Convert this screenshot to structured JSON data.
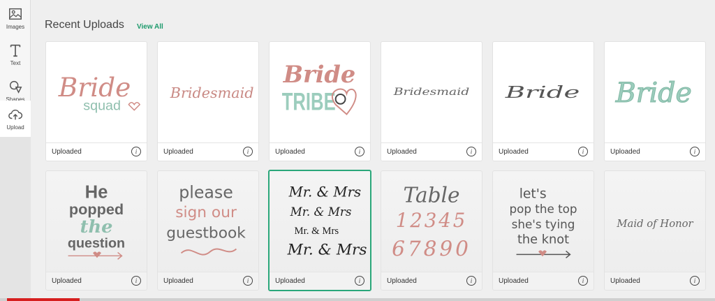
{
  "sidebar": {
    "items": [
      {
        "label": "Images",
        "icon": "image-icon"
      },
      {
        "label": "Text",
        "icon": "text-icon"
      },
      {
        "label": "Shapes",
        "icon": "shapes-icon"
      },
      {
        "label": "Upload",
        "icon": "upload-cloud-icon"
      }
    ]
  },
  "main": {
    "heading": "Recent Uploads",
    "view_all": "View All"
  },
  "cards": [
    {
      "status": "Uploaded",
      "art": [
        "Bride",
        "squad"
      ]
    },
    {
      "status": "Uploaded",
      "art": [
        "Bridesmaid"
      ]
    },
    {
      "status": "Uploaded",
      "art": [
        "Bride",
        "TRIBE"
      ]
    },
    {
      "status": "Uploaded",
      "art": [
        "Bridesmaid"
      ]
    },
    {
      "status": "Uploaded",
      "art": [
        "Bride"
      ]
    },
    {
      "status": "Uploaded",
      "art": [
        "Bride"
      ]
    },
    {
      "status": "Uploaded",
      "art": [
        "He",
        "popped",
        "the",
        "question"
      ]
    },
    {
      "status": "Uploaded",
      "art": [
        "please",
        "sign our",
        "guestbook"
      ]
    },
    {
      "status": "Uploaded",
      "art": [
        "Mr. & Mrs",
        "Mr. & Mrs",
        "Mr. & Mrs",
        "Mr. & Mrs"
      ]
    },
    {
      "status": "Uploaded",
      "art": [
        "Table",
        "12345",
        "67890"
      ]
    },
    {
      "status": "Uploaded",
      "art": [
        "let's",
        "pop the top",
        "she's tying",
        "the knot"
      ]
    },
    {
      "status": "Uploaded",
      "art": [
        "Maid of Honor"
      ]
    }
  ],
  "colors": {
    "accent": "#2aa77a",
    "pink": "#d08c86",
    "mint": "#9ccdbd",
    "gray_text": "#555555"
  }
}
